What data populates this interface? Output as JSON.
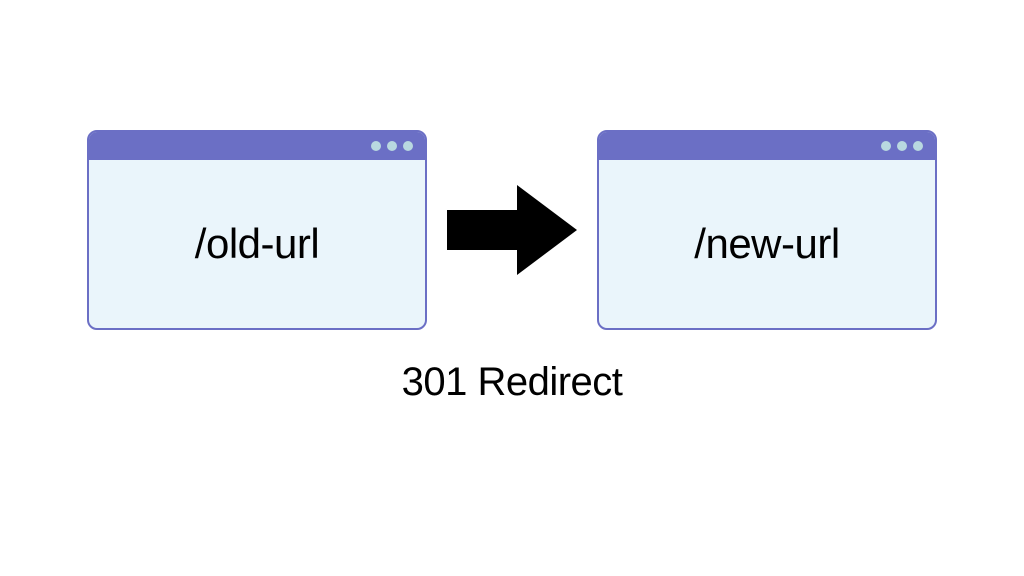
{
  "diagram": {
    "left_window": {
      "url": "/old-url"
    },
    "right_window": {
      "url": "/new-url"
    },
    "caption": "301 Redirect"
  },
  "colors": {
    "titlebar": "#6b6fc5",
    "window_bg": "#eaf5fb",
    "dot": "#b9d8e0",
    "arrow": "#000000"
  }
}
